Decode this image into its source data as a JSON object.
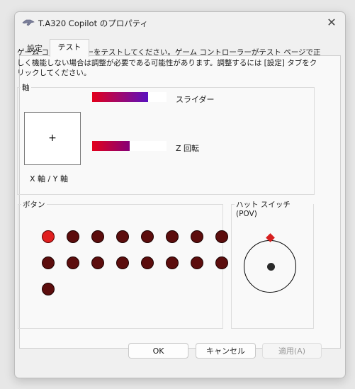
{
  "window": {
    "title": "T.A320 Copilot のプロパティ",
    "close_glyph": "✕"
  },
  "tabs": [
    {
      "label": "設定",
      "selected": false
    },
    {
      "label": "テスト",
      "selected": true
    }
  ],
  "description": "ゲーム コントローラーをテストしてください。ゲーム コントローラーがテスト ページで正しく機能しない場合は調整が必要である可能性があります。調整するには [設定] タブをクリックしてください。",
  "axes": {
    "group_label": "軸",
    "xy_label": "X 軸 / Y 軸",
    "xy_cross": "+",
    "slider": {
      "label": "スライダー",
      "level": 0.75,
      "colors": [
        "#e3001b",
        "#5a11c0"
      ]
    },
    "z_rotation": {
      "label": "Z 回転",
      "level": 0.5,
      "colors": [
        "#e3001b",
        "#860078"
      ]
    }
  },
  "buttons": {
    "group_label": "ボタン",
    "pressed": [
      true,
      false,
      false,
      false,
      false,
      false,
      false,
      false,
      false,
      false,
      false,
      false,
      false,
      false,
      false,
      false,
      false
    ],
    "on_color": "#e02020",
    "off_color": "#5c0d0d"
  },
  "pov": {
    "group_label": "ハット スイッチ (POV)",
    "direction": "up"
  },
  "footer": {
    "ok_label": "OK",
    "cancel_label": "キャンセル",
    "apply_label": "適用(A)",
    "apply_enabled": false
  }
}
